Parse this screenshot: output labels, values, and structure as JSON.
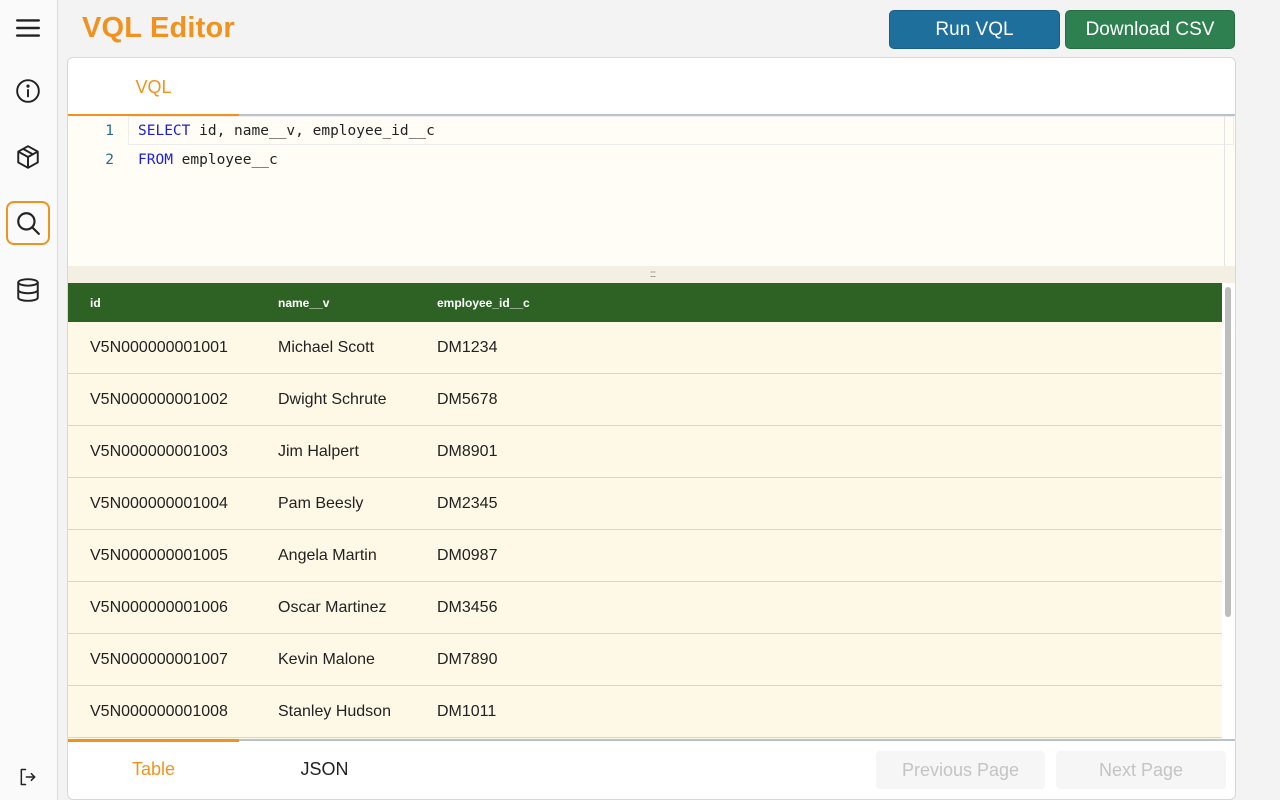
{
  "header": {
    "title": "VQL Editor",
    "run_label": "Run VQL",
    "download_label": "Download CSV"
  },
  "sidebar": {
    "items": [
      {
        "icon": "menu-icon",
        "active": false
      },
      {
        "icon": "info-icon",
        "active": false
      },
      {
        "icon": "package-icon",
        "active": false
      },
      {
        "icon": "search-icon",
        "active": true
      },
      {
        "icon": "database-icon",
        "active": false
      },
      {
        "icon": "logout-icon",
        "active": false
      }
    ]
  },
  "editor": {
    "tab_label": "VQL",
    "lines": [
      {
        "num": "1",
        "keyword": "SELECT",
        "rest": " id, name__v, employee_id__c"
      },
      {
        "num": "2",
        "keyword": "FROM",
        "rest": " employee__c"
      }
    ],
    "resize_handle": ":::"
  },
  "table": {
    "columns": [
      "id",
      "name__v",
      "employee_id__c"
    ],
    "rows": [
      [
        "V5N000000001001",
        "Michael Scott",
        "DM1234"
      ],
      [
        "V5N000000001002",
        "Dwight Schrute",
        "DM5678"
      ],
      [
        "V5N000000001003",
        "Jim Halpert",
        "DM8901"
      ],
      [
        "V5N000000001004",
        "Pam Beesly",
        "DM2345"
      ],
      [
        "V5N000000001005",
        "Angela Martin",
        "DM0987"
      ],
      [
        "V5N000000001006",
        "Oscar Martinez",
        "DM3456"
      ],
      [
        "V5N000000001007",
        "Kevin Malone",
        "DM7890"
      ],
      [
        "V5N000000001008",
        "Stanley Hudson",
        "DM1011"
      ]
    ]
  },
  "footer": {
    "tabs": [
      "Table",
      "JSON"
    ],
    "active_tab": "Table",
    "prev_label": "Previous Page",
    "next_label": "Next Page"
  },
  "colors": {
    "accent": "#f0931e",
    "run_button": "#1e6f9c",
    "download_button": "#2e8051",
    "table_header": "#2d6224",
    "row_background": "#fef8e6"
  }
}
